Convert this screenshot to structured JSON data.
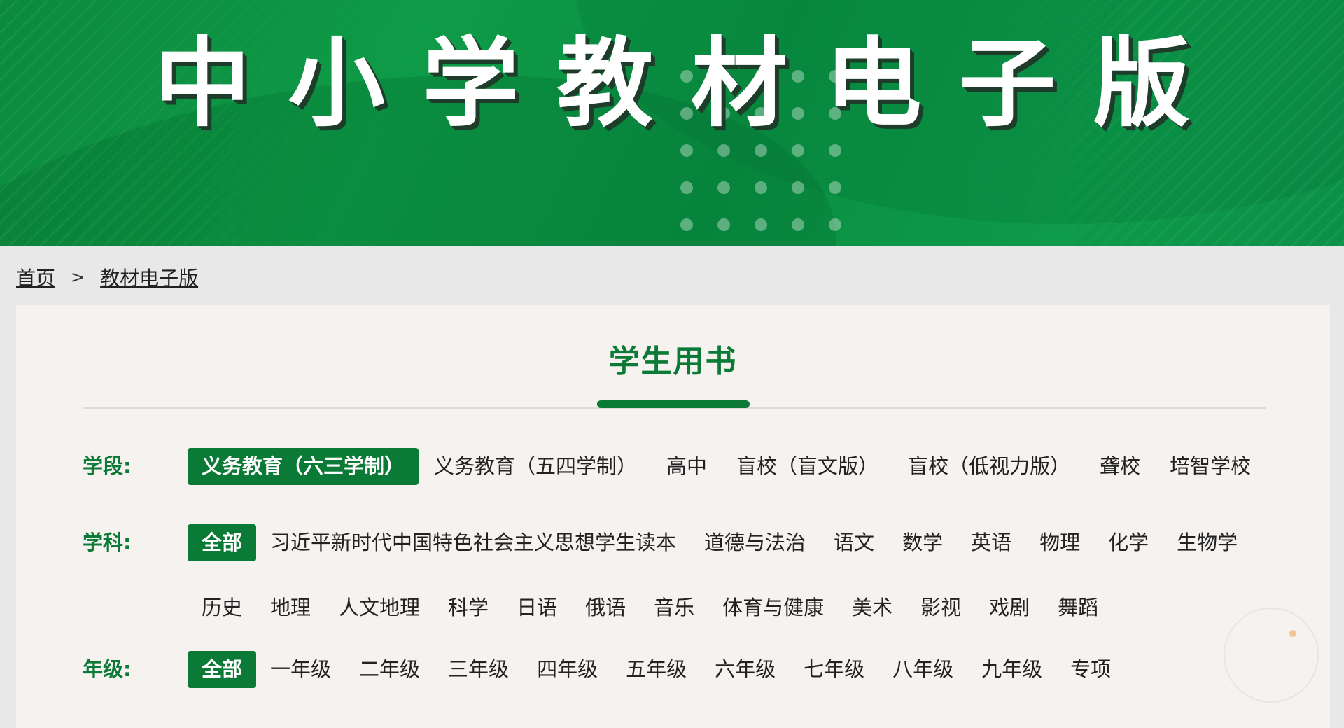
{
  "banner": {
    "title_chars": [
      "中",
      "小",
      "学",
      "教",
      "材",
      "电",
      "子",
      "版"
    ]
  },
  "breadcrumb": {
    "home": "首页",
    "separator": ">",
    "current": "教材电子版"
  },
  "section": {
    "title": "学生用书"
  },
  "filters": {
    "stage": {
      "label": "学段:",
      "items": [
        "义务教育（六三学制）",
        "义务教育（五四学制）",
        "高中",
        "盲校（盲文版）",
        "盲校（低视力版）",
        "聋校",
        "培智学校"
      ],
      "selected": "义务教育（六三学制）"
    },
    "subject": {
      "label": "学科:",
      "items": [
        "全部",
        "习近平新时代中国特色社会主义思想学生读本",
        "道德与法治",
        "语文",
        "数学",
        "英语",
        "物理",
        "化学",
        "生物学",
        "历史",
        "地理",
        "人文地理",
        "科学",
        "日语",
        "俄语",
        "音乐",
        "体育与健康",
        "美术",
        "影视",
        "戏剧",
        "舞蹈"
      ],
      "selected": "全部"
    },
    "grade": {
      "label": "年级:",
      "items": [
        "全部",
        "一年级",
        "二年级",
        "三年级",
        "四年级",
        "五年级",
        "六年级",
        "七年级",
        "八年级",
        "九年级",
        "专项"
      ],
      "selected": "全部"
    }
  },
  "colors": {
    "brand_green": "#0b7a36",
    "banner_green": "#0e9b47",
    "panel_bg": "#f5f2f0",
    "page_bg": "#e8e8e8"
  }
}
